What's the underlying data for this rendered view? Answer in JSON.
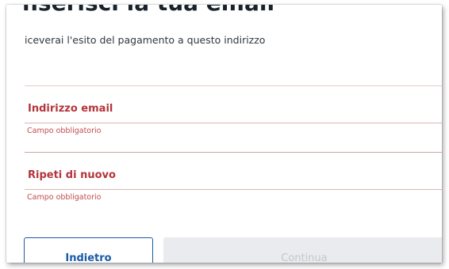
{
  "header": {
    "title": "nserisci la tua email",
    "subtitle": "iceverai l'esito del pagamento a questo indirizzo"
  },
  "form": {
    "email": {
      "label": "Indirizzo email",
      "error": "Campo obbligatorio"
    },
    "repeat": {
      "label": "Ripeti di nuovo",
      "error": "Campo obbligatorio"
    }
  },
  "actions": {
    "back_label": "Indietro",
    "continue_label": "Continua"
  },
  "colors": {
    "error": "#b3353c",
    "primary": "#1a5aa6",
    "disabled_bg": "#e9ebee"
  }
}
